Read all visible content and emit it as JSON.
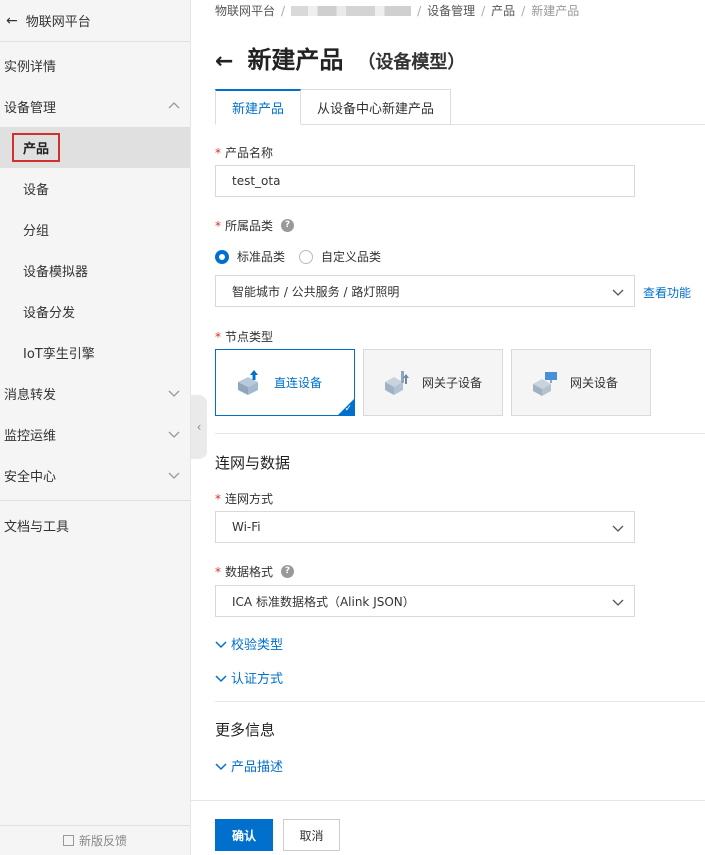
{
  "colors": {
    "accent": "#0070cc",
    "required": "#d93026",
    "highlight_box": "#d0312d"
  },
  "sidebar": {
    "back_icon": "arrow-left-icon",
    "title": "物联网平台",
    "items": [
      {
        "label": "实例详情",
        "type": "top"
      },
      {
        "label": "设备管理",
        "type": "top",
        "expanded": true
      },
      {
        "label": "产品",
        "type": "sub",
        "active": true
      },
      {
        "label": "设备",
        "type": "sub"
      },
      {
        "label": "分组",
        "type": "sub"
      },
      {
        "label": "设备模拟器",
        "type": "sub"
      },
      {
        "label": "设备分发",
        "type": "sub"
      },
      {
        "label": "IoT孪生引擎",
        "type": "sub"
      },
      {
        "label": "消息转发",
        "type": "top"
      },
      {
        "label": "监控运维",
        "type": "top"
      },
      {
        "label": "安全中心",
        "type": "top"
      },
      {
        "label": "文档与工具",
        "type": "top"
      }
    ],
    "feedback": "新版反馈"
  },
  "breadcrumb": {
    "items": [
      "物联网平台",
      "设备管理",
      "产品"
    ],
    "current": "新建产品"
  },
  "header": {
    "title": "新建产品",
    "subtitle": "（设备模型）"
  },
  "tabs": [
    {
      "label": "新建产品",
      "active": true
    },
    {
      "label": "从设备中心新建产品",
      "active": false
    }
  ],
  "form": {
    "product_name": {
      "label": "产品名称",
      "value": "test_ota"
    },
    "category": {
      "label": "所属品类",
      "options": [
        {
          "label": "标准品类",
          "checked": true
        },
        {
          "label": "自定义品类",
          "checked": false
        }
      ],
      "selected": "智能城市 / 公共服务 / 路灯照明",
      "link": "查看功能"
    },
    "node_type": {
      "label": "节点类型",
      "cards": [
        {
          "label": "直连设备",
          "icon": "direct-device-icon",
          "selected": true
        },
        {
          "label": "网关子设备",
          "icon": "gateway-subdevice-icon",
          "selected": false
        },
        {
          "label": "网关设备",
          "icon": "gateway-device-icon",
          "selected": false
        }
      ]
    },
    "network_section": "连网与数据",
    "connection": {
      "label": "连网方式",
      "value": "Wi-Fi"
    },
    "data_format": {
      "label": "数据格式",
      "value": "ICA 标准数据格式（Alink JSON）"
    },
    "verify_type": "校验类型",
    "auth_method": "认证方式",
    "more_section": "更多信息",
    "product_desc": "产品描述"
  },
  "actions": {
    "confirm": "确认",
    "cancel": "取消"
  }
}
